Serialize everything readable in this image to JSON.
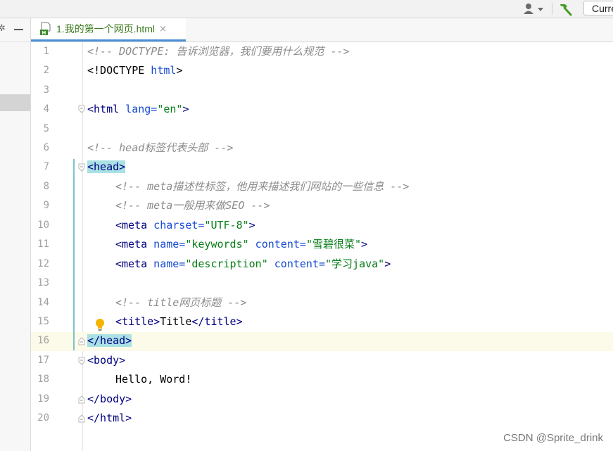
{
  "toolbar": {
    "run_config_label": "Current File",
    "user_icon": "user-icon",
    "build_icon": "hammer-icon"
  },
  "tab": {
    "title": "1.我的第一个网页.html",
    "close_glyph": "×",
    "file_icon": "html-file-icon",
    "file_icon_label": "H"
  },
  "editor": {
    "line_numbers": [
      "1",
      "2",
      "3",
      "4",
      "5",
      "6",
      "7",
      "8",
      "9",
      "10",
      "11",
      "12",
      "13",
      "14",
      "15",
      "16",
      "17",
      "18",
      "19",
      "20"
    ],
    "current_line": "16",
    "lines": {
      "l1": {
        "comment": "<!-- DOCTYPE: 告诉浏览器，我们要用什么规范 -->"
      },
      "l2": {
        "doctype": "<!DOCTYPE",
        "html": " html",
        "close": ">"
      },
      "l4": {
        "open": "<html",
        "attr": " lang=",
        "val": "\"en\"",
        "close": ">"
      },
      "l6": {
        "comment": "<!-- head标签代表头部 -->"
      },
      "l7": {
        "tag": "<head>"
      },
      "l8": {
        "comment": "<!-- meta描述性标签，他用来描述我们网站的一些信息 -->"
      },
      "l9": {
        "comment": "<!-- meta一般用来做SEO -->"
      },
      "l10": {
        "open": "<meta",
        "attr": " charset=",
        "val": "\"UTF-8\"",
        "close": ">"
      },
      "l11": {
        "open": "<meta",
        "attr1": " name=",
        "val1": "\"keywords\"",
        "attr2": " content=",
        "val2": "\"雪碧很菜\"",
        "close": ">"
      },
      "l12": {
        "open": "<meta",
        "attr1": " name=",
        "val1": "\"description\"",
        "attr2": " content=",
        "val2": "\"学习java\"",
        "close": ">"
      },
      "l14": {
        "comment": "<!-- title网页标题 -->"
      },
      "l15": {
        "open": "<title>",
        "text": "Title",
        "close": "</title>"
      },
      "l16": {
        "tag": "</head>"
      },
      "l17": {
        "tag": "<body>"
      },
      "l18": {
        "text": "Hello, Word!"
      },
      "l19": {
        "tag": "</body>"
      },
      "l20": {
        "tag": "</html>"
      }
    }
  },
  "colors": {
    "comment": "#8c8c8c",
    "tag": "#000080",
    "attribute": "#174ad4",
    "string": "#067d17",
    "tab_underline": "#4b8fd6",
    "current_line_bg": "#fcfae8",
    "tag_match_bg": "#a9e1e5"
  },
  "watermark": "CSDN @Sprite_drink"
}
